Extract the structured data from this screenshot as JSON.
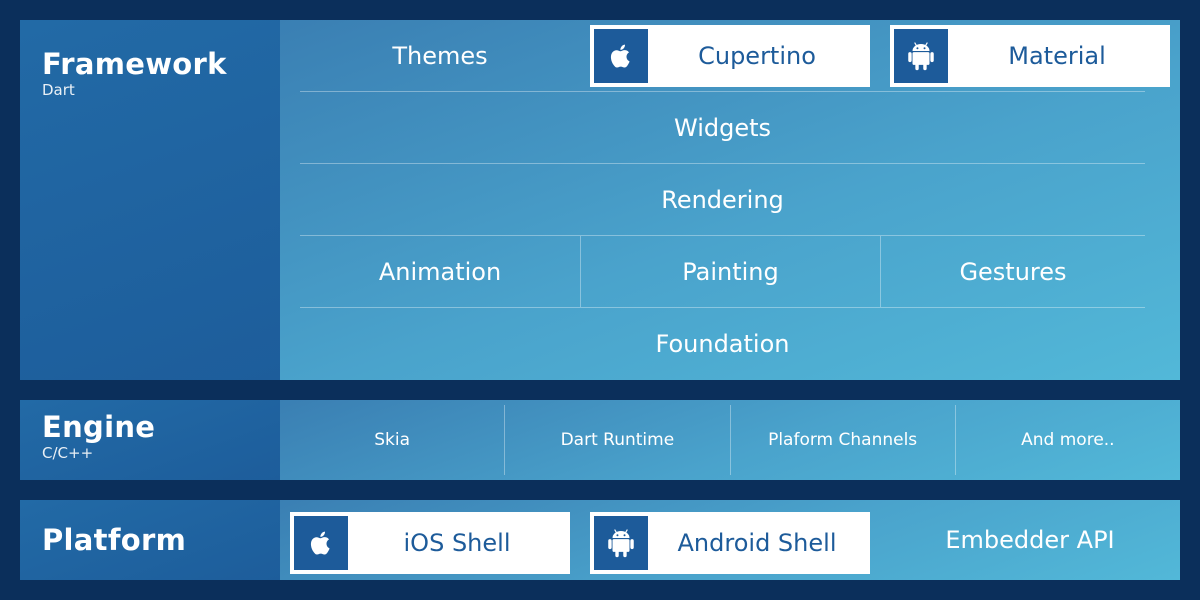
{
  "framework": {
    "title": "Framework",
    "sub": "Dart",
    "themes": "Themes",
    "cupertino": "Cupertino",
    "material": "Material",
    "widgets": "Widgets",
    "rendering": "Rendering",
    "animation": "Animation",
    "painting": "Painting",
    "gestures": "Gestures",
    "foundation": "Foundation"
  },
  "engine": {
    "title": "Engine",
    "sub": "C/C++",
    "items": [
      "Skia",
      "Dart Runtime",
      "Plaform Channels",
      "And more.."
    ]
  },
  "platform": {
    "title": "Platform",
    "ios": "iOS Shell",
    "android": "Android Shell",
    "embedder": "Embedder API"
  },
  "colors": {
    "background": "#0b2f5b",
    "label": "#1f62a0",
    "accent": "#1d5b9a"
  }
}
